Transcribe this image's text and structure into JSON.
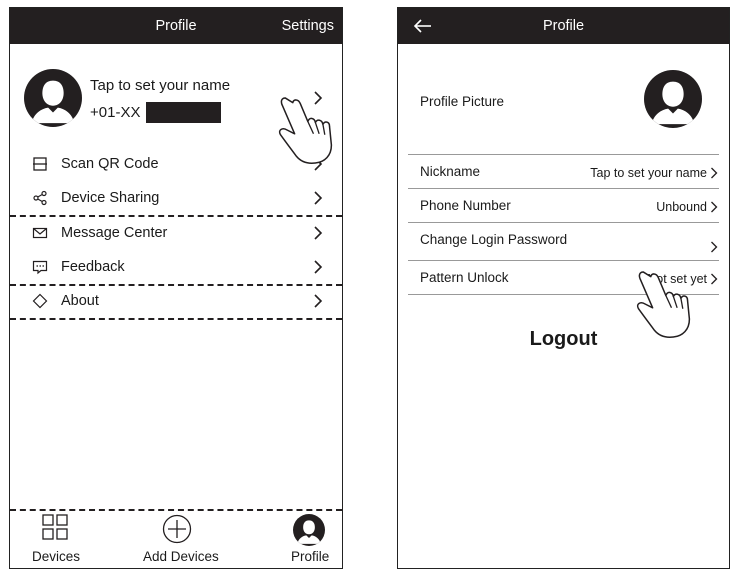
{
  "left_screen": {
    "header": {
      "title": "Profile",
      "settings_label": "Settings"
    },
    "profile": {
      "name_prompt": "Tap to set your name",
      "phone": "+01-XX"
    },
    "menu": [
      {
        "label": "Scan QR Code",
        "icon": "scan-icon"
      },
      {
        "label": "Device Sharing",
        "icon": "share-icon"
      },
      {
        "label": "Message Center",
        "icon": "envelope-icon"
      },
      {
        "label": "Feedback",
        "icon": "feedback-icon"
      },
      {
        "label": "About",
        "icon": "diamond-icon"
      }
    ],
    "bottom_nav": [
      {
        "label": "Devices",
        "icon": "grid-icon"
      },
      {
        "label": "Add Devices",
        "icon": "plus-circle-icon"
      },
      {
        "label": "Profile",
        "icon": "profile-icon"
      }
    ]
  },
  "right_screen": {
    "header": {
      "title": "Profile"
    },
    "rows": {
      "profile_picture": {
        "label": "Profile Picture"
      },
      "nickname": {
        "label": "Nickname",
        "value": "Tap to set your name"
      },
      "phone_number": {
        "label": "Phone Number",
        "value": "Unbound"
      },
      "change_password": {
        "label": "Change Login Password"
      },
      "pattern_unlock": {
        "label": "Pattern Unlock",
        "value": "Not set yet"
      }
    },
    "logout_label": "Logout"
  }
}
